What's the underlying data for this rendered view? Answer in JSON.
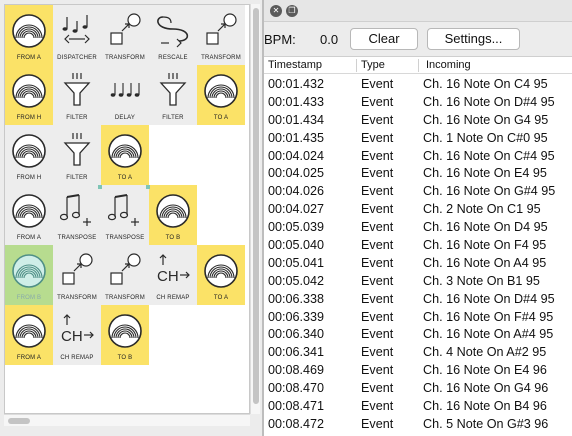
{
  "patcher": {
    "cells": [
      {
        "name": "from-a-node-1",
        "label": "FROM A",
        "icon": "midi-port-icon",
        "bg": "yellow",
        "row": 0,
        "col": 0
      },
      {
        "name": "dispatcher-node",
        "label": "DISPATCHER",
        "icon": "dispatcher-icon",
        "bg": "gray",
        "row": 0,
        "col": 1
      },
      {
        "name": "transform-node-1",
        "label": "TRANSFORM",
        "icon": "transform-icon",
        "bg": "gray",
        "row": 0,
        "col": 2
      },
      {
        "name": "rescale-node",
        "label": "RESCALE",
        "icon": "rescale-icon",
        "bg": "gray",
        "row": 0,
        "col": 3
      },
      {
        "name": "transform-node-2",
        "label": "TRANSFORM",
        "icon": "transform-icon",
        "bg": "gray",
        "row": 0,
        "col": 4
      },
      {
        "name": "from-h-node-1",
        "label": "FROM H",
        "icon": "midi-port-icon",
        "bg": "yellow",
        "row": 1,
        "col": 0
      },
      {
        "name": "filter-node-1",
        "label": "FILTER",
        "icon": "filter-icon",
        "bg": "gray",
        "row": 1,
        "col": 1
      },
      {
        "name": "delay-node",
        "label": "DELAY",
        "icon": "delay-icon",
        "bg": "gray",
        "row": 1,
        "col": 2
      },
      {
        "name": "filter-node-2",
        "label": "FILTER",
        "icon": "filter-icon",
        "bg": "gray",
        "row": 1,
        "col": 3
      },
      {
        "name": "to-a-node-1",
        "label": "TO A",
        "icon": "midi-port-icon",
        "bg": "yellow",
        "row": 1,
        "col": 4
      },
      {
        "name": "from-h-node-2",
        "label": "FROM H",
        "icon": "midi-port-icon",
        "bg": "gray",
        "row": 2,
        "col": 0
      },
      {
        "name": "filter-node-3",
        "label": "FILTER",
        "icon": "filter-icon",
        "bg": "gray",
        "row": 2,
        "col": 1
      },
      {
        "name": "to-a-node-2",
        "label": "TO A",
        "icon": "midi-port-icon",
        "bg": "yellow",
        "row": 2,
        "col": 2
      },
      {
        "name": "from-a-node-2",
        "label": "FROM A",
        "icon": "midi-port-icon",
        "bg": "gray",
        "row": 3,
        "col": 0
      },
      {
        "name": "transpose-node-1",
        "label": "TRANSPOSE",
        "icon": "transpose-icon",
        "bg": "gray",
        "row": 3,
        "col": 1
      },
      {
        "name": "transpose-node-2",
        "label": "TRANSPOSE",
        "icon": "transpose-icon",
        "bg": "gray",
        "row": 3,
        "col": 2
      },
      {
        "name": "to-b-node-1",
        "label": "TO B",
        "icon": "midi-port-icon",
        "bg": "yellow",
        "row": 3,
        "col": 3
      },
      {
        "name": "from-b-node",
        "label": "FROM B",
        "icon": "midi-port-icon",
        "bg": "green",
        "row": 4,
        "col": 0
      },
      {
        "name": "transform-node-3",
        "label": "TRANSFORM",
        "icon": "transform-icon",
        "bg": "gray",
        "row": 4,
        "col": 1
      },
      {
        "name": "transform-node-4",
        "label": "TRANSFORM",
        "icon": "transform-icon",
        "bg": "gray",
        "row": 4,
        "col": 2
      },
      {
        "name": "ch-remap-node-1",
        "label": "CH REMAP",
        "icon": "ch-remap-icon",
        "bg": "gray",
        "row": 4,
        "col": 3
      },
      {
        "name": "to-a-node-3",
        "label": "TO A",
        "icon": "midi-port-icon",
        "bg": "yellow",
        "row": 4,
        "col": 4
      },
      {
        "name": "from-a-node-3",
        "label": "FROM A",
        "icon": "midi-port-icon",
        "bg": "yellow",
        "row": 5,
        "col": 0
      },
      {
        "name": "ch-remap-node-2",
        "label": "CH REMAP",
        "icon": "ch-remap-icon",
        "bg": "gray",
        "row": 5,
        "col": 1
      },
      {
        "name": "to-b-node-2",
        "label": "TO B",
        "icon": "midi-port-icon",
        "bg": "yellow",
        "row": 5,
        "col": 2
      }
    ]
  },
  "monitor": {
    "bpm_label": "BPM:",
    "bpm_value": "0.0",
    "clear_label": "Clear",
    "settings_label": "Settings...",
    "columns": [
      "Timestamp",
      "Type",
      "Incoming"
    ],
    "rows": [
      {
        "ts": "00:01.432",
        "type": "Event",
        "msg": "Ch. 16 Note On C4 95"
      },
      {
        "ts": "00:01.433",
        "type": "Event",
        "msg": "Ch. 16 Note On D#4 95"
      },
      {
        "ts": "00:01.434",
        "type": "Event",
        "msg": "Ch. 16 Note On G4 95"
      },
      {
        "ts": "00:01.435",
        "type": "Event",
        "msg": "Ch. 1 Note On C#0 95"
      },
      {
        "ts": "00:04.024",
        "type": "Event",
        "msg": "Ch. 16 Note On C#4 95"
      },
      {
        "ts": "00:04.025",
        "type": "Event",
        "msg": "Ch. 16 Note On E4 95"
      },
      {
        "ts": "00:04.026",
        "type": "Event",
        "msg": "Ch. 16 Note On G#4 95"
      },
      {
        "ts": "00:04.027",
        "type": "Event",
        "msg": "Ch. 2 Note On C1 95"
      },
      {
        "ts": "00:05.039",
        "type": "Event",
        "msg": "Ch. 16 Note On D4 95"
      },
      {
        "ts": "00:05.040",
        "type": "Event",
        "msg": "Ch. 16 Note On F4 95"
      },
      {
        "ts": "00:05.041",
        "type": "Event",
        "msg": "Ch. 16 Note On A4 95"
      },
      {
        "ts": "00:05.042",
        "type": "Event",
        "msg": "Ch. 3 Note On B1 95"
      },
      {
        "ts": "00:06.338",
        "type": "Event",
        "msg": "Ch. 16 Note On D#4 95"
      },
      {
        "ts": "00:06.339",
        "type": "Event",
        "msg": "Ch. 16 Note On F#4 95"
      },
      {
        "ts": "00:06.340",
        "type": "Event",
        "msg": "Ch. 16 Note On A#4 95"
      },
      {
        "ts": "00:06.341",
        "type": "Event",
        "msg": "Ch. 4 Note On A#2 95"
      },
      {
        "ts": "00:08.469",
        "type": "Event",
        "msg": "Ch. 16 Note On E4 96"
      },
      {
        "ts": "00:08.470",
        "type": "Event",
        "msg": "Ch. 16 Note On G4 96"
      },
      {
        "ts": "00:08.471",
        "type": "Event",
        "msg": "Ch. 16 Note On B4 96"
      },
      {
        "ts": "00:08.472",
        "type": "Event",
        "msg": "Ch. 5 Note On G#3 96"
      }
    ]
  },
  "colors": {
    "node_yellow": "#fbe267",
    "node_gray": "#ededed",
    "node_green": "#b7dc8f",
    "connector": "#7fc5b6"
  }
}
